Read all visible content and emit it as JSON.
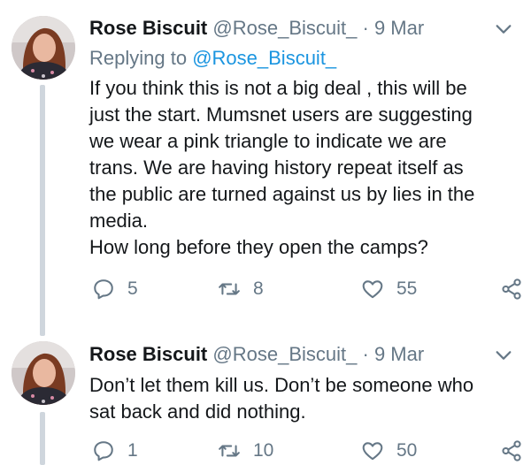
{
  "tweets": [
    {
      "author_name": "Rose Biscuit",
      "author_handle": "@Rose_Biscuit_",
      "separator": "·",
      "date": "9 Mar",
      "replying_prefix": "Replying to",
      "replying_to": "@Rose_Biscuit_",
      "text_lines": [
        "If you think this is not a big deal , this will be",
        "just the start. Mumsnet users are suggesting",
        "we wear a pink triangle to indicate we are",
        "trans. We are having history repeat itself as",
        "the public are turned against us by lies in the",
        "media.",
        "How long before they open the camps?"
      ],
      "replies": "5",
      "retweets": "8",
      "likes": "55"
    },
    {
      "author_name": "Rose Biscuit",
      "author_handle": "@Rose_Biscuit_",
      "separator": "·",
      "date": "9 Mar",
      "text_lines": [
        "Don’t let them kill us. Don’t be someone who",
        "sat back and did nothing."
      ],
      "replies": "1",
      "retweets": "10",
      "likes": "50"
    }
  ],
  "icons": {
    "reply": "reply-icon",
    "retweet": "retweet-icon",
    "like": "heart-icon",
    "share": "share-icon",
    "caret": "chevron-down-icon"
  },
  "colors": {
    "text": "#14171a",
    "muted": "#657786",
    "link": "#1b95e0",
    "thread_line": "#cfd6dd"
  }
}
